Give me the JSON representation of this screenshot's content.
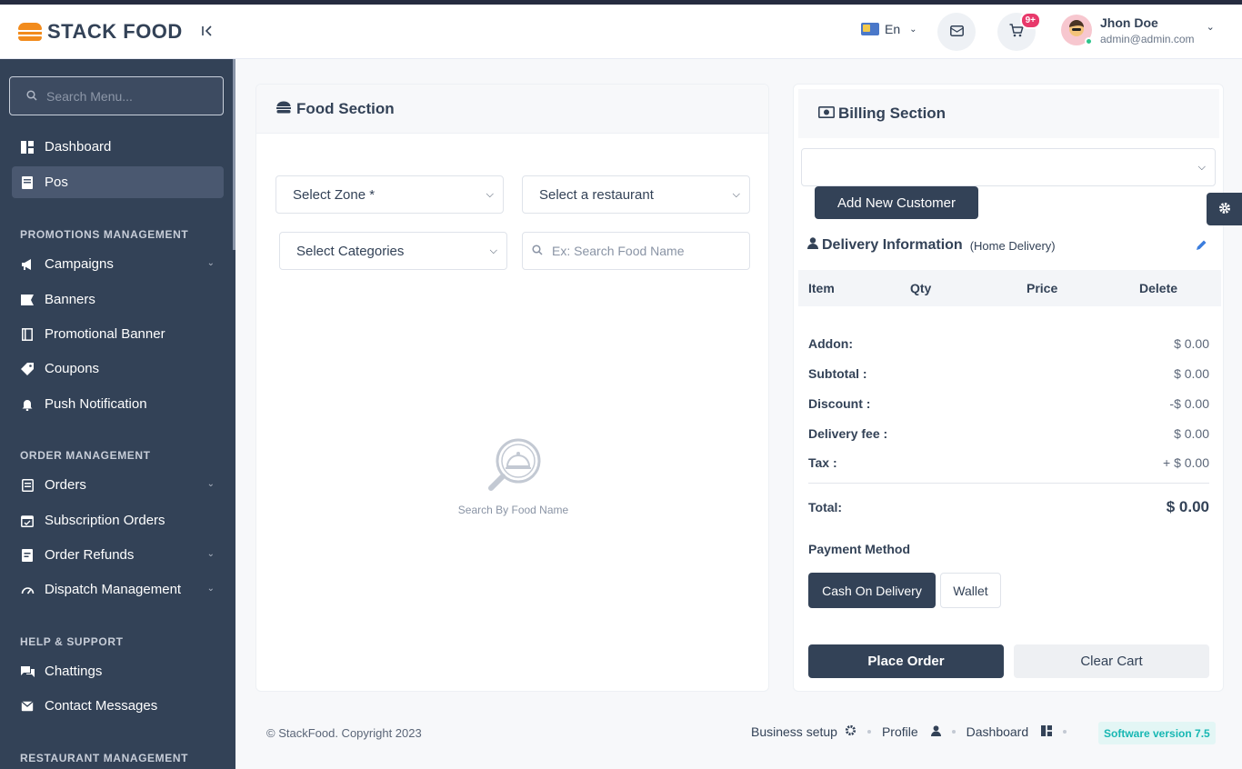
{
  "brand": {
    "name": "STACK FOOD"
  },
  "sidebar": {
    "search_placeholder": "Search Menu...",
    "items": {
      "dashboard": "Dashboard",
      "pos": "Pos",
      "campaigns": "Campaigns",
      "banners": "Banners",
      "promotional_banner": "Promotional Banner",
      "coupons": "Coupons",
      "push_notification": "Push Notification",
      "orders": "Orders",
      "subscription_orders": "Subscription Orders",
      "order_refunds": "Order Refunds",
      "dispatch_management": "Dispatch Management",
      "chattings": "Chattings",
      "contact_messages": "Contact Messages"
    },
    "sections": {
      "promotions": "PROMOTIONS MANAGEMENT",
      "orders": "ORDER MANAGEMENT",
      "help": "HELP & SUPPORT",
      "restaurant": "RESTAURANT MANAGEMENT"
    }
  },
  "header": {
    "language": "En",
    "cart_badge": "9+",
    "user": {
      "name": "Jhon Doe",
      "email": "admin@admin.com"
    }
  },
  "food": {
    "title": "Food Section",
    "zone": "Select Zone *",
    "restaurant": "Select a restaurant",
    "categories": "Select Categories",
    "search_placeholder": "Ex: Search Food Name",
    "empty_text": "Search By Food Name"
  },
  "billing": {
    "title": "Billing Section",
    "add_customer": "Add New Customer",
    "delivery_title": "Delivery Information",
    "delivery_type": "(Home Delivery)",
    "columns": {
      "item": "Item",
      "qty": "Qty",
      "price": "Price",
      "delete": "Delete"
    },
    "summary": {
      "addon": {
        "label": "Addon:",
        "value": "$ 0.00"
      },
      "subtotal": {
        "label": "Subtotal :",
        "value": "$ 0.00"
      },
      "discount": {
        "label": "Discount :",
        "value": "-$ 0.00"
      },
      "delivery": {
        "label": "Delivery fee :",
        "value": "$ 0.00"
      },
      "tax": {
        "label": "Tax :",
        "value": "+ $ 0.00"
      },
      "total": {
        "label": "Total:",
        "value": "$ 0.00"
      }
    },
    "payment_title": "Payment Method",
    "cash": "Cash On Delivery",
    "wallet": "Wallet",
    "place_order": "Place Order",
    "clear_cart": "Clear Cart"
  },
  "footer": {
    "copyright": "© StackFood. Copyright 2023",
    "business_setup": "Business setup",
    "profile": "Profile",
    "dashboard": "Dashboard",
    "version": "Software version 7.5"
  },
  "colors": {
    "primary": "#334257",
    "accent": "#f28b1c",
    "badge": "#e8396b",
    "teal": "#17b7b3"
  }
}
